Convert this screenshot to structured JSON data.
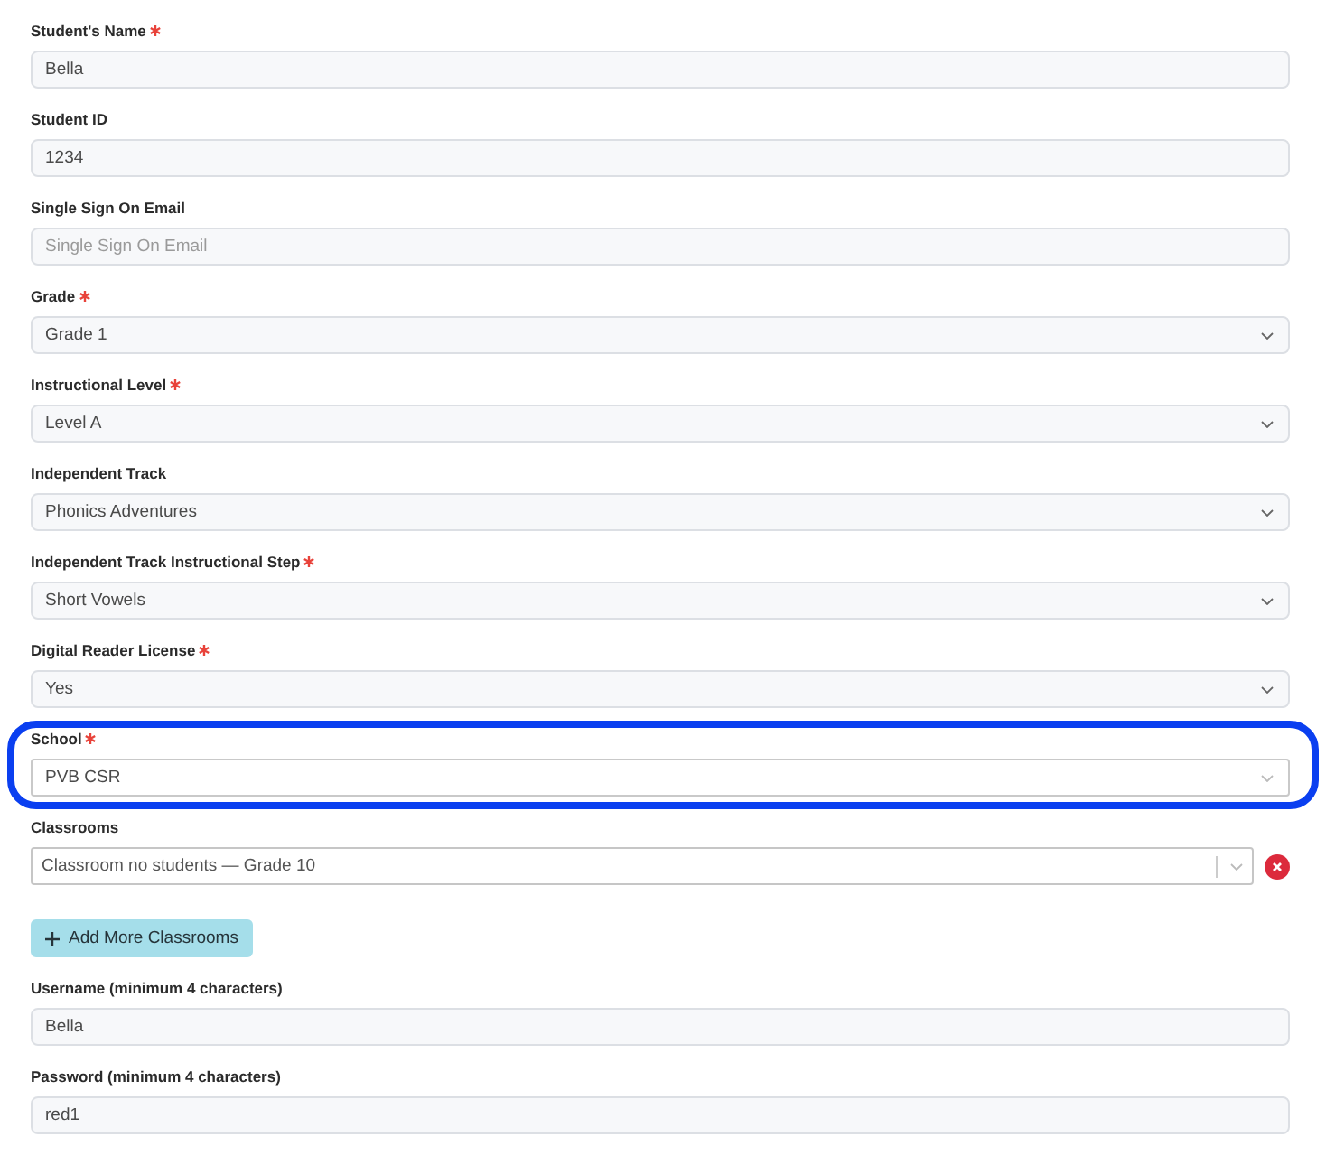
{
  "fields": [
    {
      "label": "Student's Name",
      "required": true,
      "kind": "text",
      "value": "Bella",
      "highlighted": false
    },
    {
      "label": "Student ID",
      "required": false,
      "kind": "text",
      "value": "1234",
      "highlighted": false
    },
    {
      "label": "Single Sign On Email",
      "required": false,
      "kind": "text",
      "placeholder": "Single Sign On Email",
      "highlighted": false
    },
    {
      "label": "Grade",
      "required": true,
      "kind": "select",
      "value": "Grade 1",
      "highlighted": false
    },
    {
      "label": "Instructional Level",
      "required": true,
      "kind": "select",
      "value": "Level A",
      "highlighted": false
    },
    {
      "label": "Independent Track",
      "required": false,
      "kind": "select",
      "value": "Phonics Adventures",
      "highlighted": false
    },
    {
      "label": "Independent Track Instructional Step",
      "required": true,
      "kind": "select",
      "value": "Short Vowels",
      "highlighted": false
    },
    {
      "label": "Digital Reader License",
      "required": true,
      "kind": "select",
      "value": "Yes",
      "highlighted": false
    },
    {
      "label": "School",
      "required": true,
      "kind": "dropdown",
      "value": "PVB CSR",
      "highlighted": true
    }
  ],
  "classrooms": {
    "label": "Classrooms",
    "items": [
      {
        "value": "Classroom no students — Grade 10"
      }
    ],
    "add_button": "Add More Classrooms"
  },
  "account_fields": [
    {
      "label": "Username (minimum 4 characters)",
      "required": false,
      "kind": "text",
      "value": "Bella"
    },
    {
      "label": "Password (minimum 4 characters)",
      "required": false,
      "kind": "text",
      "value": "red1"
    }
  ]
}
